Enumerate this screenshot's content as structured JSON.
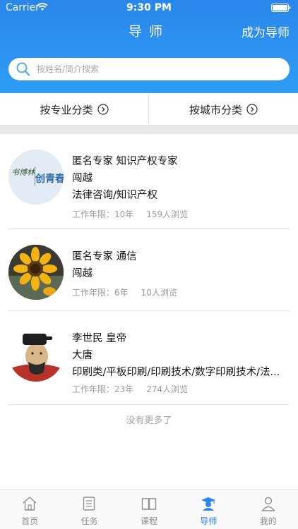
{
  "status_bar": {
    "carrier": "Carrier",
    "time": "9:30 PM"
  },
  "nav": {
    "title": "导师",
    "action": "成为导师"
  },
  "search": {
    "placeholder": "按姓名/简介搜索"
  },
  "filters": [
    {
      "label": "按专业分类"
    },
    {
      "label": "按城市分类"
    }
  ],
  "mentors": [
    {
      "line1": "匿名专家  知识产权专家",
      "line2": "闯越",
      "line3": "法律咨询/知识产权",
      "years_label": "工作年限：10年",
      "views_label": "159人浏览",
      "avatar_text": "创青春",
      "avatar_script": "书博林"
    },
    {
      "line1": "匿名专家  通信",
      "line2": "闯越",
      "line3": "",
      "years_label": "工作年限：6年",
      "views_label": "10人浏览"
    },
    {
      "line1": "李世民  皇帝",
      "line2": "大唐",
      "line3": "印刷类/平板印刷/印刷技术/数字印刷技术/法...",
      "years_label": "工作年限：23年",
      "views_label": "274人浏览"
    }
  ],
  "list_footer": "没有更多了",
  "tabs": [
    {
      "label": "首页",
      "icon": "home-icon"
    },
    {
      "label": "任务",
      "icon": "task-icon"
    },
    {
      "label": "课程",
      "icon": "book-icon"
    },
    {
      "label": "导师",
      "icon": "mentor-icon",
      "active": true
    },
    {
      "label": "我的",
      "icon": "profile-icon"
    }
  ],
  "colors": {
    "brand_blue": "#2a86ec",
    "bg_gray": "#e9e9e9",
    "meta_gray": "#9a9a9a"
  }
}
